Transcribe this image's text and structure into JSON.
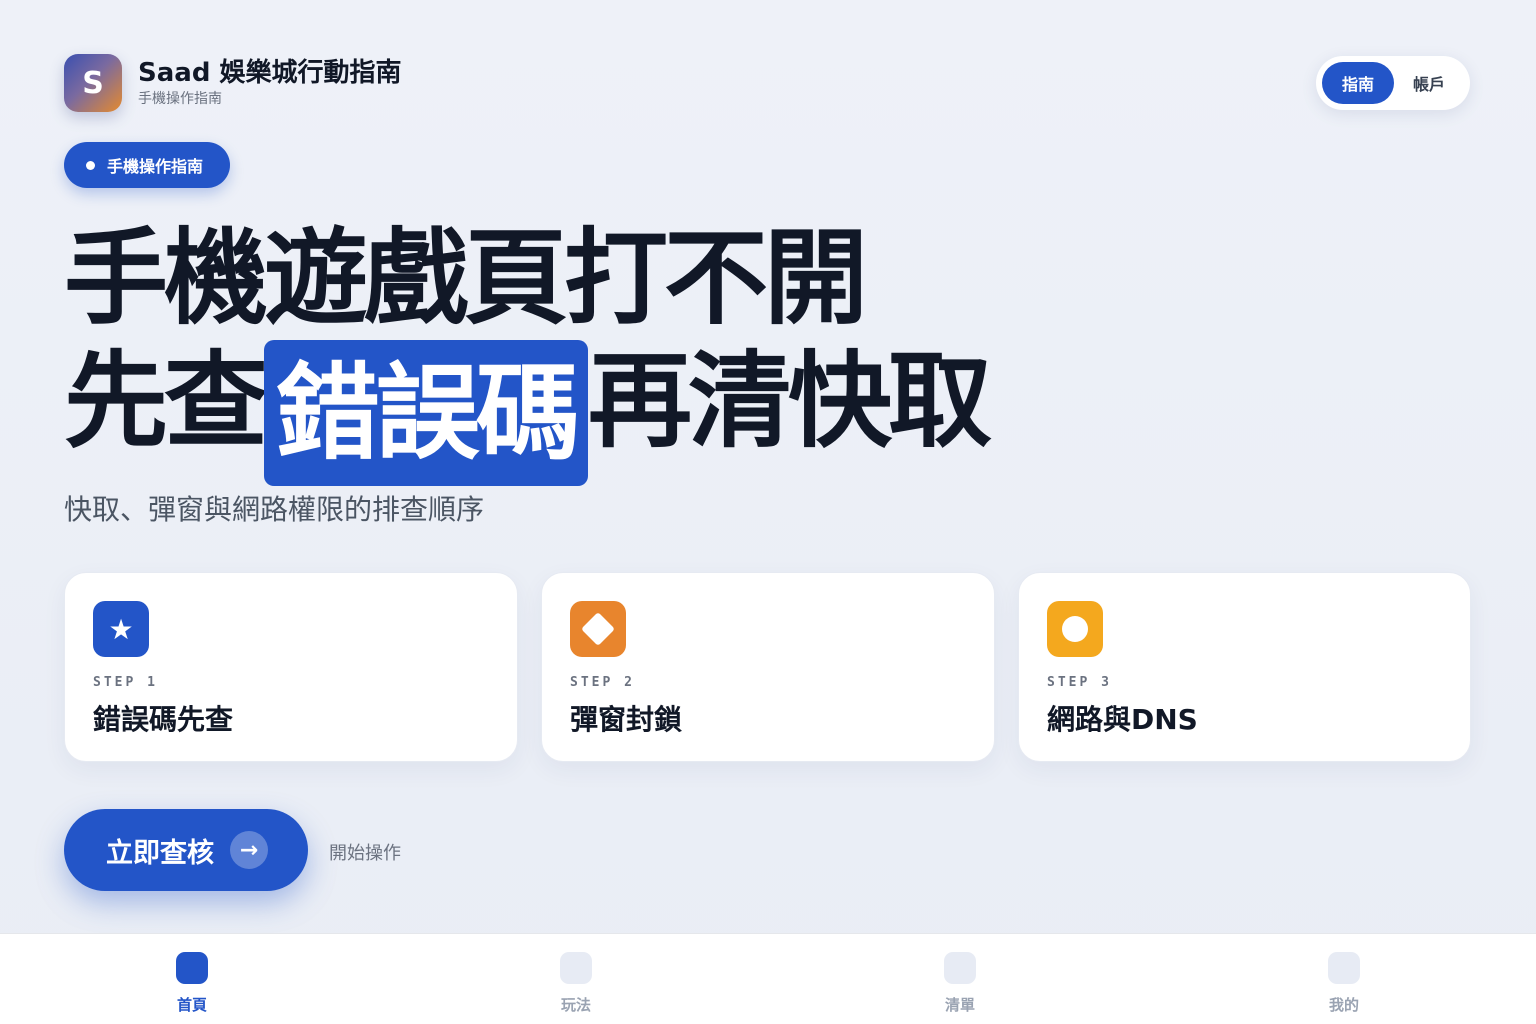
{
  "brand": {
    "logo_letter": "S",
    "title": "Saad 娛樂城行動指南",
    "subtitle": "手機操作指南"
  },
  "segmented": {
    "active_label": "指南",
    "other_label": "帳戶"
  },
  "badge": {
    "label": "手機操作指南"
  },
  "hero": {
    "line1": "手機遊戲頁打不開",
    "line2_before": "先查",
    "line2_highlight": "錯誤碼",
    "line2_after": "再清快取",
    "subtitle": "快取、彈窗與網路權限的排查順序"
  },
  "cards": [
    {
      "step": "STEP 1",
      "title": "錯誤碼先查",
      "icon": "star-icon",
      "color": "#2355c8"
    },
    {
      "step": "STEP 2",
      "title": "彈窗封鎖",
      "icon": "diamond-icon",
      "color": "#e8852d"
    },
    {
      "step": "STEP 3",
      "title": "網路與DNS",
      "icon": "circle-icon",
      "color": "#f4a81e"
    }
  ],
  "cta": {
    "label": "立即查核",
    "arrow": "→",
    "hint": "開始操作"
  },
  "tabs": [
    {
      "label": "首頁",
      "active": true
    },
    {
      "label": "玩法",
      "active": false
    },
    {
      "label": "清單",
      "active": false
    },
    {
      "label": "我的",
      "active": false
    }
  ],
  "colors": {
    "accent": "#2355c8",
    "orange": "#e8852d",
    "yellow": "#f4a81e",
    "text": "#111827"
  }
}
